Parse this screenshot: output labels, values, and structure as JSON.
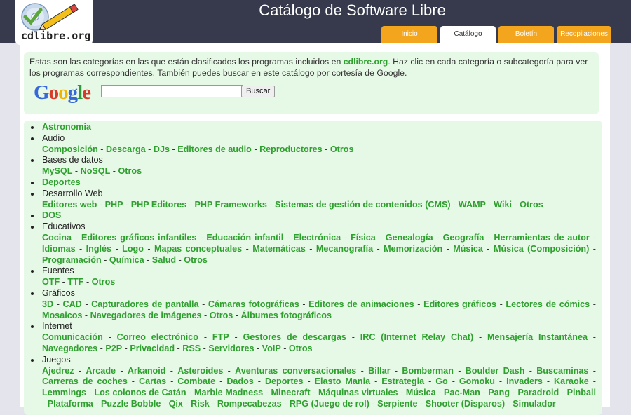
{
  "header": {
    "title": "Catálogo de Software Libre",
    "logo_text": "cdlibre.org",
    "tabs": [
      {
        "label": "Inicio"
      },
      {
        "label": "Catálogo"
      },
      {
        "label": "Boletín"
      },
      {
        "label": "Recopilaciones"
      }
    ]
  },
  "intro": {
    "text_before": "Estas son las categorías en las que están clasificados los programas incluidos en ",
    "link": "cdlibre.org",
    "text_after": ". Haz clic en cada categoría o subcategoría para ver los programas correspondientes. También puedes buscar en este catálogo por cortesía de Google.",
    "google_logo": "Google",
    "search_value": "",
    "search_button": "Buscar"
  },
  "categories": [
    {
      "name": "Astronomia",
      "link": true,
      "subs": []
    },
    {
      "name": "Audio",
      "link": false,
      "subs": [
        "Composición",
        "Descarga",
        "DJs",
        "Editores de audio",
        "Reproductores",
        "Otros"
      ]
    },
    {
      "name": "Bases de datos",
      "link": false,
      "subs": [
        "MySQL",
        "NoSQL",
        "Otros"
      ]
    },
    {
      "name": "Deportes",
      "link": true,
      "subs": []
    },
    {
      "name": "Desarrollo Web",
      "link": false,
      "subs": [
        "Editores web",
        "PHP",
        "PHP Editores",
        "PHP Frameworks",
        "Sistemas de gestión de contenidos (CMS)",
        "WAMP",
        "Wiki",
        "Otros"
      ]
    },
    {
      "name": "DOS",
      "link": true,
      "subs": []
    },
    {
      "name": "Educativos",
      "link": false,
      "subs": [
        "Cocina",
        "Editores gráficos infantiles",
        "Educación infantil",
        "Electrónica",
        "Física",
        "Genealogía",
        "Geografía",
        "Herramientas de autor",
        "Idiomas",
        "Inglés",
        "Logo",
        "Mapas conceptuales",
        "Matemáticas",
        "Mecanografía",
        "Memorización",
        "Música",
        "Música (Composición)",
        "Programación",
        "Química",
        "Salud",
        "Otros"
      ]
    },
    {
      "name": "Fuentes",
      "link": false,
      "subs": [
        "OTF",
        "TTF",
        "Otros"
      ]
    },
    {
      "name": "Gráficos",
      "link": false,
      "subs": [
        "3D",
        "CAD",
        "Capturadores de pantalla",
        "Cámaras fotográficas",
        "Editores de animaciones",
        "Editores gráficos",
        "Lectores de cómics",
        "Mosaicos",
        "Navegadores de imágenes",
        "Otros",
        "Álbumes fotográficos"
      ]
    },
    {
      "name": "Internet",
      "link": false,
      "subs": [
        "Comunicación",
        "Correo electrónico",
        "FTP",
        "Gestores de descargas",
        "IRC (Internet Relay Chat)",
        "Mensajería Instantánea",
        "Navegadores",
        "P2P",
        "Privacidad",
        "RSS",
        "Servidores",
        "VoIP",
        "Otros"
      ]
    },
    {
      "name": "Juegos",
      "link": false,
      "subs": [
        "Ajedrez",
        "Arcade",
        "Arkanoid",
        "Asteroides",
        "Aventuras conversacionales",
        "Billar",
        "Bomberman",
        "Boulder Dash",
        "Buscaminas",
        "Carreras de coches",
        "Cartas",
        "Combate",
        "Dados",
        "Deportes",
        "Elasto Mania",
        "Estrategia",
        "Go",
        "Gomoku",
        "Invaders",
        "Karaoke",
        "Lemmings",
        "Los colonos de Catán",
        "Marble Madness",
        "Minecraft",
        "Máquinas virtuales",
        "Música",
        "Pac-Man",
        "Pang",
        "Paradroid",
        "Pinball",
        "Plataforma",
        "Puzzle Bobble",
        "Qix",
        "Risk",
        "Rompecabezas",
        "RPG (Juego de rol)",
        "Serpiente",
        "Shooter (Disparos)",
        "Simulador"
      ]
    }
  ]
}
